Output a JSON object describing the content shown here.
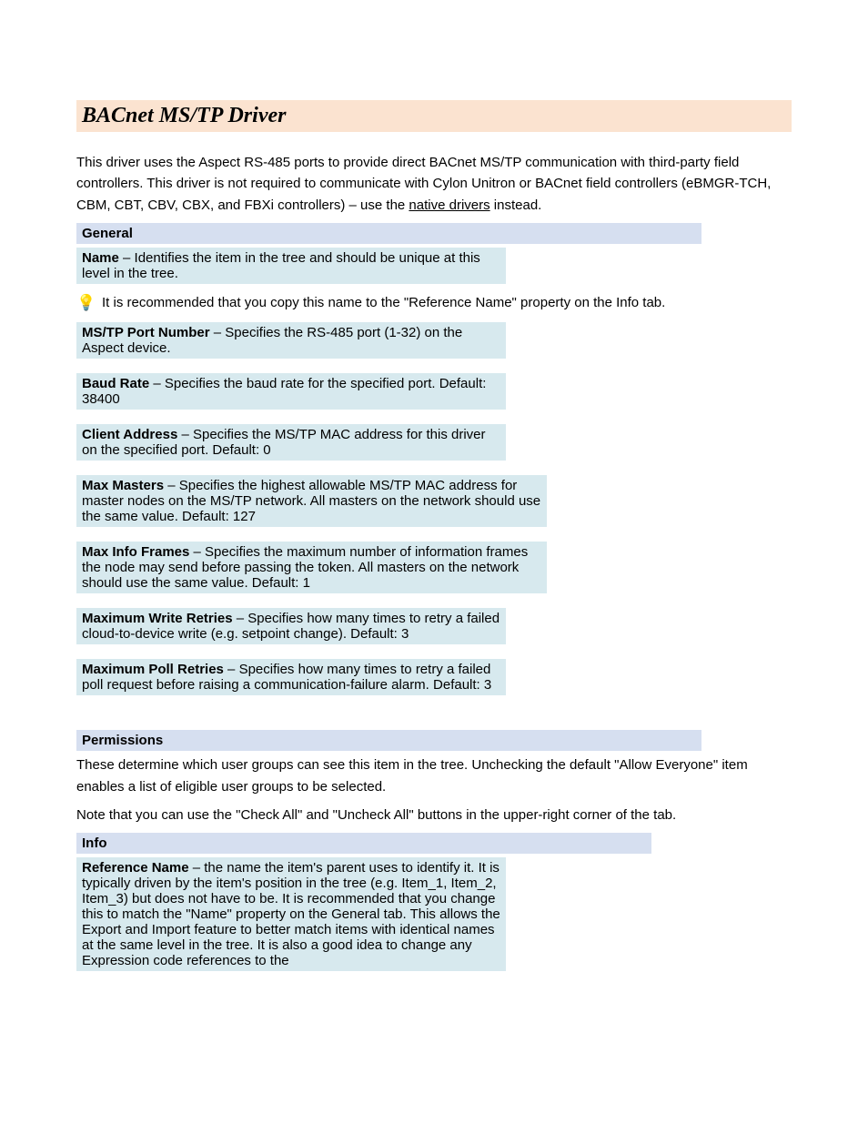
{
  "heading": "BACnet MS/TP Driver",
  "intro": "This driver uses the Aspect RS-485 ports to provide direct BACnet MS/TP communication with third-party field controllers.  This driver is not required to communicate with Cylon Unitron or BACnet field controllers (eBMGR-TCH, CBM, CBT, CBV, CBX, and FBXi controllers) – use the ",
  "intro_link": "native drivers",
  "intro_end": " instead.",
  "section_general": "General",
  "prop_name_label": "Name",
  "prop_name_text": " – Identifies the item in the tree and should be unique at this level in the tree.",
  "tip_icon": "💡",
  "tip_text": "It is recommended that you copy this name to the \"Reference Name\" property on the Info tab.",
  "prop_mstp_label": "MS/TP Port Number",
  "prop_mstp_text": " – Specifies the RS-485 port (1-32) on the Aspect device.",
  "prop_baud_label": "Baud Rate",
  "prop_baud_text": " – Specifies the baud rate for the specified port.  Default: 38400",
  "prop_addr_label": "Client Address",
  "prop_addr_text": " – Specifies the MS/TP MAC address for this driver on the specified port.  Default: 0",
  "prop_maxmaster_label": "Max Masters",
  "prop_maxmaster_text": " – Specifies the highest allowable MS/TP MAC address for master nodes on the MS/TP network.  All masters on the network should use the same value.  Default: 127",
  "prop_info_label": "Max Info Frames",
  "prop_info_text": " – Specifies the maximum number of information frames the node may send before passing the token.  All masters on the network should use the same value.  Default: 1",
  "prop_write_label": "Maximum Write Retries",
  "prop_write_text": " – Specifies how many times to retry a failed cloud-to-device write (e.g. setpoint change).  Default: 3",
  "prop_poll_label": "Maximum Poll Retries",
  "prop_poll_text": " – Specifies how many times to retry a failed poll request before raising a communication-failure alarm.  Default: 3",
  "section_perm": "Permissions",
  "perm_text_1": "These determine which user groups can see this item in the tree.  Unchecking the default \"Allow Everyone\" item enables a list of eligible user groups to be selected.",
  "perm_text_2": "Note that you can use the \"Check All\" and \"Uncheck All\" buttons in the upper-right corner of the tab.",
  "section_info": "Info",
  "prop_ref_label": "Reference Name",
  "prop_ref_text": " – the name the item's parent uses to identify it.  It is typically driven by the item's position in the tree (e.g. Item_1, Item_2, Item_3) but does not have to be.  It is recommended that you change this to match the \"Name\" property on the General tab.  This allows the Export and Import feature to better match items with identical names at the same level in the tree.  It is also a good idea to change any Expression code references to the"
}
